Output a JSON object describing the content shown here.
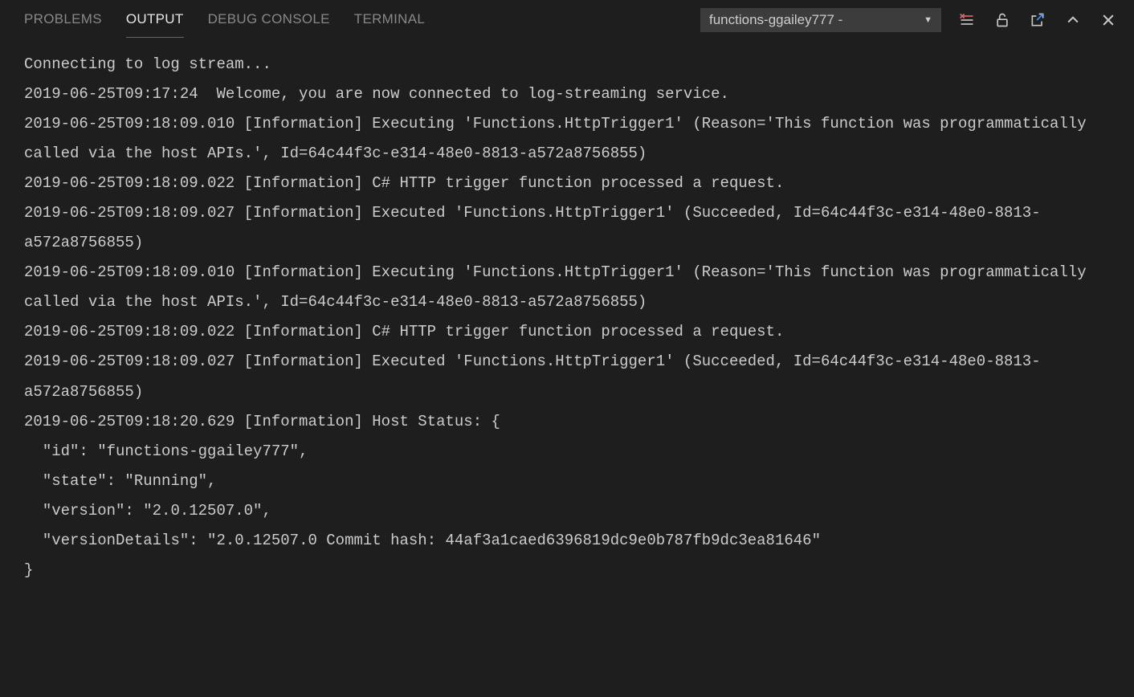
{
  "tabs": {
    "problems": "PROBLEMS",
    "output": "OUTPUT",
    "debug_console": "DEBUG CONSOLE",
    "terminal": "TERMINAL"
  },
  "dropdown": {
    "selected": "functions-ggailey777 -"
  },
  "output": {
    "lines": [
      "Connecting to log stream...",
      "2019-06-25T09:17:24  Welcome, you are now connected to log-streaming service.",
      "2019-06-25T09:18:09.010 [Information] Executing 'Functions.HttpTrigger1' (Reason='This function was programmatically called via the host APIs.', Id=64c44f3c-e314-48e0-8813-a572a8756855)",
      "2019-06-25T09:18:09.022 [Information] C# HTTP trigger function processed a request.",
      "2019-06-25T09:18:09.027 [Information] Executed 'Functions.HttpTrigger1' (Succeeded, Id=64c44f3c-e314-48e0-8813-a572a8756855)",
      "2019-06-25T09:18:09.010 [Information] Executing 'Functions.HttpTrigger1' (Reason='This function was programmatically called via the host APIs.', Id=64c44f3c-e314-48e0-8813-a572a8756855)",
      "2019-06-25T09:18:09.022 [Information] C# HTTP trigger function processed a request.",
      "2019-06-25T09:18:09.027 [Information] Executed 'Functions.HttpTrigger1' (Succeeded, Id=64c44f3c-e314-48e0-8813-a572a8756855)",
      "2019-06-25T09:18:20.629 [Information] Host Status: {",
      "  \"id\": \"functions-ggailey777\",",
      "  \"state\": \"Running\",",
      "  \"version\": \"2.0.12507.0\",",
      "  \"versionDetails\": \"2.0.12507.0 Commit hash: 44af3a1caed6396819dc9e0b787fb9dc3ea81646\"",
      "}"
    ]
  }
}
